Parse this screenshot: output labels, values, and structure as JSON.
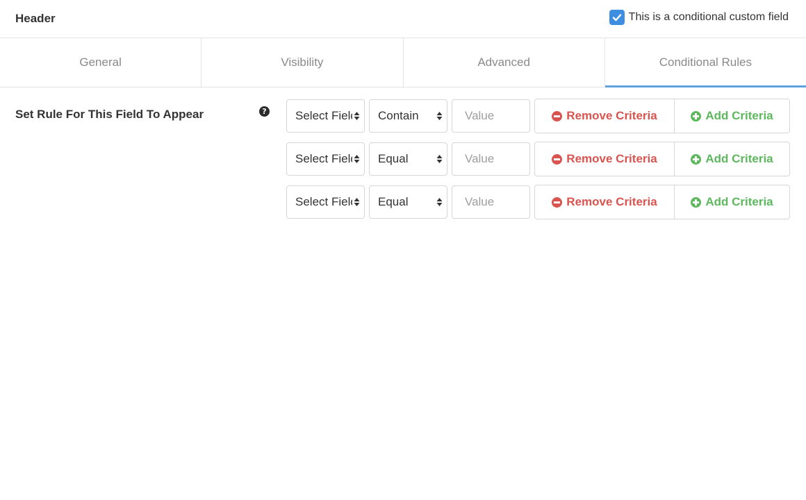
{
  "header": {
    "title": "Header",
    "conditional_label": "This is a conditional custom field",
    "conditional_checked": true
  },
  "tabs": [
    {
      "label": "General",
      "active": false
    },
    {
      "label": "Visibility",
      "active": false
    },
    {
      "label": "Advanced",
      "active": false
    },
    {
      "label": "Conditional Rules",
      "active": true
    }
  ],
  "rules_section": {
    "label": "Set Rule For This Field To Appear",
    "help_icon": "question-circle-icon",
    "rows": [
      {
        "field": "Select Field",
        "operator": "Contain",
        "value": "",
        "value_placeholder": "Value",
        "remove_label": "Remove Criteria",
        "add_label": "Add Criteria"
      },
      {
        "field": "Select Field",
        "operator": "Equal",
        "value": "",
        "value_placeholder": "Value",
        "remove_label": "Remove Criteria",
        "add_label": "Add Criteria"
      },
      {
        "field": "Select Field",
        "operator": "Equal",
        "value": "",
        "value_placeholder": "Value",
        "remove_label": "Remove Criteria",
        "add_label": "Add Criteria"
      }
    ]
  },
  "colors": {
    "accent": "#5fa2dd",
    "checkbox": "#3d8ee0",
    "remove": "#d9534f",
    "add": "#5cb85c"
  }
}
